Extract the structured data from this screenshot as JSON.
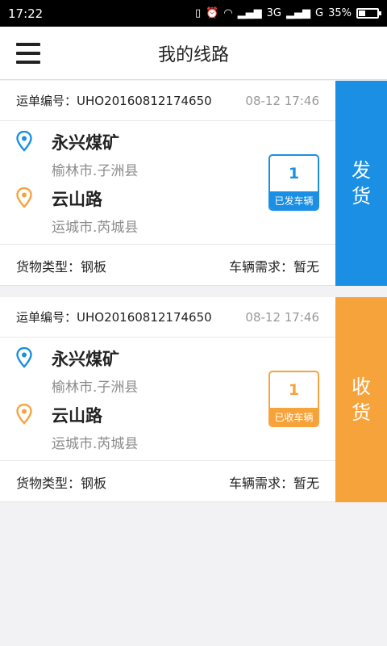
{
  "status_bar": {
    "time": "17:22",
    "network": "3G",
    "network2": "G",
    "battery": "35%"
  },
  "header": {
    "title": "我的线路"
  },
  "orders": [
    {
      "order_label": "运单编号：UHO20160812174650",
      "time": "08-12 17:46",
      "from_place": "永兴煤矿",
      "from_region": "榆林市.子洲县",
      "to_place": "云山路",
      "to_region": "运城市.芮城县",
      "vehicle_count": "1",
      "vehicle_label": "已发车辆",
      "cargo": "货物类型：钢板",
      "demand": "车辆需求：暂无",
      "action_line1": "发",
      "action_line2": "货",
      "color": "#1a8fe3"
    },
    {
      "order_label": "运单编号：UHO20160812174650",
      "time": "08-12 17:46",
      "from_place": "永兴煤矿",
      "from_region": "榆林市.子洲县",
      "to_place": "云山路",
      "to_region": "运城市.芮城县",
      "vehicle_count": "1",
      "vehicle_label": "已收车辆",
      "cargo": "货物类型：钢板",
      "demand": "车辆需求：暂无",
      "action_line1": "收",
      "action_line2": "货",
      "color": "#f7a33c"
    }
  ],
  "icons": {
    "from": "location-pin-blue-icon",
    "to": "location-pin-orange-icon",
    "menu": "hamburger-menu-icon"
  }
}
